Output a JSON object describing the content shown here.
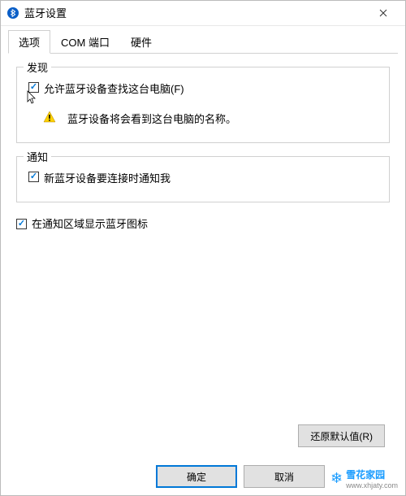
{
  "window": {
    "title": "蓝牙设置",
    "close": "✕"
  },
  "tabs": {
    "options": "选项",
    "com": "COM 端口",
    "hardware": "硬件"
  },
  "discovery": {
    "title": "发现",
    "allow_label": "允许蓝牙设备查找这台电脑(F)",
    "info_text": "蓝牙设备将会看到这台电脑的名称。"
  },
  "notification": {
    "title": "通知",
    "notify_label": "新蓝牙设备要连接时通知我"
  },
  "tray": {
    "label": "在通知区域显示蓝牙图标"
  },
  "buttons": {
    "restore": "还原默认值(R)",
    "ok": "确定",
    "cancel": "取消"
  },
  "watermark": {
    "name": "雪花家园",
    "url": "www.xhjaty.com"
  }
}
